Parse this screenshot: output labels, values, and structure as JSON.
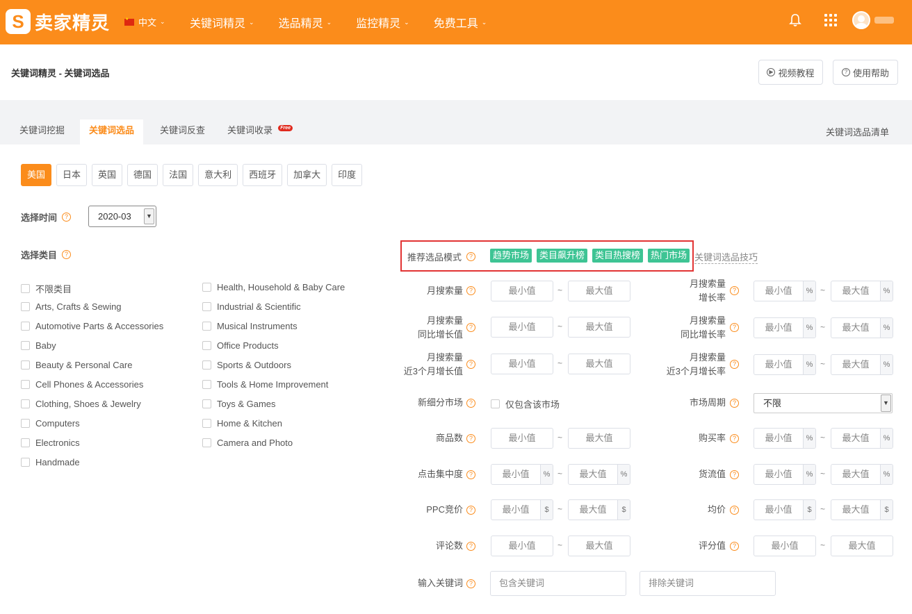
{
  "header": {
    "logo_mark": "S",
    "logo_text": "卖家精灵",
    "language": "中文",
    "nav": [
      "关键词精灵",
      "选品精灵",
      "监控精灵",
      "免费工具"
    ]
  },
  "breadcrumb": "关键词精灵 - 关键词选品",
  "help_buttons": {
    "video": "视频教程",
    "help": "使用帮助"
  },
  "tabs": [
    {
      "label": "关键词挖掘",
      "active": false
    },
    {
      "label": "关键词选品",
      "active": true
    },
    {
      "label": "关键词反查",
      "active": false
    },
    {
      "label": "关键词收录",
      "active": false,
      "badge": "Free"
    }
  ],
  "tab_right": "关键词选品清单",
  "countries": [
    {
      "label": "美国",
      "active": true
    },
    {
      "label": "日本"
    },
    {
      "label": "英国"
    },
    {
      "label": "德国"
    },
    {
      "label": "法国"
    },
    {
      "label": "意大利"
    },
    {
      "label": "西班牙"
    },
    {
      "label": "加拿大"
    },
    {
      "label": "印度"
    }
  ],
  "time": {
    "label": "选择时间",
    "value": "2020-03"
  },
  "category": {
    "label": "选择类目",
    "left": [
      "不限类目",
      "Arts, Crafts & Sewing",
      "Automotive Parts & Accessories",
      "Baby",
      "Beauty & Personal Care",
      "Cell Phones & Accessories",
      "Clothing, Shoes & Jewelry",
      "Computers",
      "Electronics",
      "Handmade"
    ],
    "right": [
      "Health, Household & Baby Care",
      "Industrial & Scientific",
      "Musical Instruments",
      "Office Products",
      "Sports & Outdoors",
      "Tools & Home Improvement",
      "Toys & Games",
      "Home & Kitchen",
      "Camera and Photo"
    ]
  },
  "recommend": {
    "label": "推荐选品模式",
    "tags": [
      "趋势市场",
      "类目飙升榜",
      "类目热搜榜",
      "热门市场"
    ],
    "tip": "关键词选品技巧",
    "tag_color": "#3ec494",
    "highlight_color": "#e23333"
  },
  "filters": {
    "min": "最小值",
    "max": "最大值",
    "tilde": "~",
    "pct": "%",
    "usd": "$",
    "monthly_search": "月搜索量",
    "monthly_growth": [
      "月搜索量",
      "增长率"
    ],
    "yoy_value": [
      "月搜索量",
      "同比增长值"
    ],
    "yoy_rate": [
      "月搜索量",
      "同比增长率"
    ],
    "m3_value": [
      "月搜索量",
      "近3个月增长值"
    ],
    "m3_rate": [
      "月搜索量",
      "近3个月增长率"
    ],
    "new_niche": "新细分市场",
    "new_niche_option": "仅包含该市场",
    "cycle": "市场周期",
    "cycle_value": "不限",
    "products": "商品数",
    "buy_rate": "购买率",
    "click_conc": "点击集中度",
    "gmv": "货流值",
    "ppc": "PPC竞价",
    "avg_price": "均价",
    "reviews": "评论数",
    "rating": "评分值",
    "keyword": "输入关键词",
    "include_ph": "包含关键词",
    "exclude_ph": "排除关键词"
  },
  "accent_color": "#fb8c1b"
}
